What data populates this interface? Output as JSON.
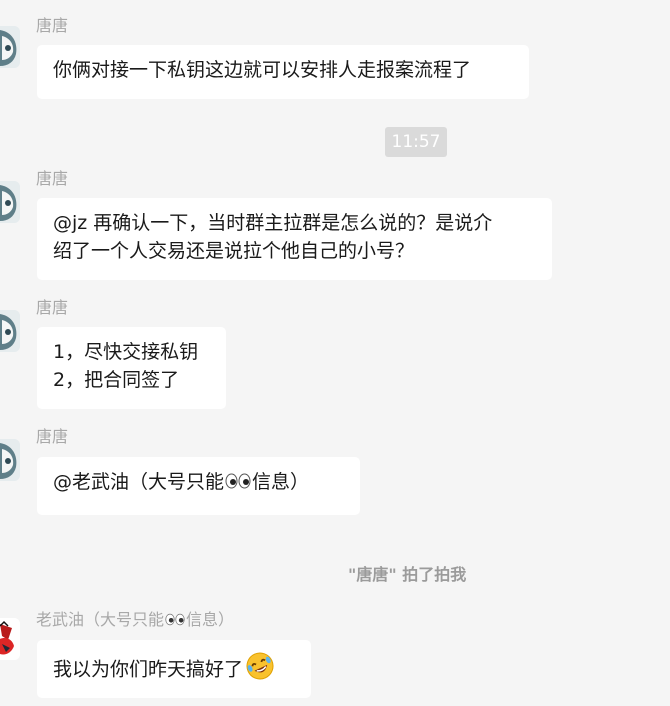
{
  "messages": [
    {
      "sender": "唐唐",
      "avatar_icon": "anime-girl-avatar-icon",
      "lines": [
        "你俩对接一下私钥这边就可以安排人走报案流程了"
      ]
    },
    {
      "sender": "唐唐",
      "avatar_icon": "anime-girl-avatar-icon",
      "lines": [
        "@jz 再确认一下，当时群主拉群是怎么说的？是说介",
        "绍了一个人交易还是说拉个他自己的小号？"
      ]
    },
    {
      "sender": "唐唐",
      "avatar_icon": "anime-girl-avatar-icon",
      "lines": [
        "1，尽快交接私钥",
        "2，把合同签了"
      ]
    },
    {
      "sender": "唐唐",
      "avatar_icon": "anime-girl-avatar-icon",
      "text_before": "@老武油（大号只能",
      "text_after": "信息）",
      "inline_icon": "eyes-emoji-icon"
    },
    {
      "sender_before": "老武油（大号只能",
      "sender_after": "信息）",
      "avatar_icon": "red-character-avatar-icon",
      "text": "我以为你们昨天搞好了",
      "inline_icon": "rofl-emoji-icon"
    }
  ],
  "timestamp": "11:57",
  "pat_notice": "\"唐唐\" 拍了拍我",
  "colors": {
    "background": "#f5f5f5",
    "bubble": "#ffffff",
    "sender_name": "#a8a8a8",
    "time_pill": "#dadada"
  }
}
